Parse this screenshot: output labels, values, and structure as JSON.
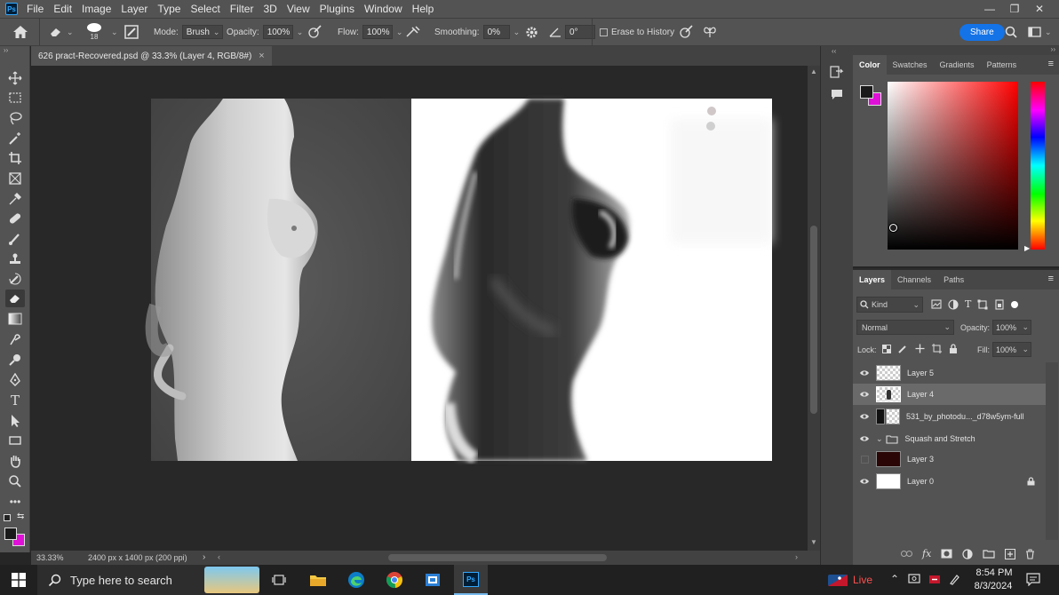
{
  "app": {
    "logo": "Ps"
  },
  "menu": [
    "File",
    "Edit",
    "Image",
    "Layer",
    "Type",
    "Select",
    "Filter",
    "3D",
    "View",
    "Plugins",
    "Window",
    "Help"
  ],
  "window_controls": {
    "minimize": "—",
    "restore": "❐",
    "close": "✕"
  },
  "options": {
    "brush_size": "18",
    "mode_label": "Mode:",
    "mode_value": "Brush",
    "opacity_label": "Opacity:",
    "opacity_value": "100%",
    "flow_label": "Flow:",
    "flow_value": "100%",
    "smoothing_label": "Smoothing:",
    "smoothing_value": "0%",
    "angle_value": "0°",
    "erase_history_label": "Erase to History",
    "share_label": "Share"
  },
  "document": {
    "tab_title": "626 pract-Recovered.psd @ 33.3% (Layer 4, RGB/8#)",
    "close_glyph": "×",
    "zoom": "33.33%",
    "size_info": "2400 px x 1400 px (200 ppi)",
    "status_arrow": "›"
  },
  "color_panel": {
    "tabs": [
      "Color",
      "Swatches",
      "Gradients",
      "Patterns"
    ],
    "foreground": "#1a1a1a",
    "background": "#e010d8",
    "hue_color": "#ff0000"
  },
  "layers_panel": {
    "tabs": [
      "Layers",
      "Channels",
      "Paths"
    ],
    "filter_kind": "Kind",
    "blend_mode": "Normal",
    "opacity_label": "Opacity:",
    "opacity_value": "100%",
    "lock_label": "Lock:",
    "fill_label": "Fill:",
    "fill_value": "100%",
    "layers": [
      {
        "name": "Layer 5",
        "visible": true,
        "selected": false
      },
      {
        "name": "Layer 4",
        "visible": true,
        "selected": true
      },
      {
        "name": "531_by_photodu..._d78w5ym-full",
        "visible": true,
        "selected": false
      },
      {
        "name": "Squash and Stretch",
        "visible": true,
        "selected": false,
        "group": true
      },
      {
        "name": "Layer 3",
        "visible": false,
        "selected": false
      },
      {
        "name": "Layer 0",
        "visible": true,
        "selected": false,
        "locked": true
      }
    ]
  },
  "taskbar": {
    "search_placeholder": "Type here to search",
    "live_label": "Live",
    "time": "8:54 PM",
    "date": "8/3/2024"
  }
}
